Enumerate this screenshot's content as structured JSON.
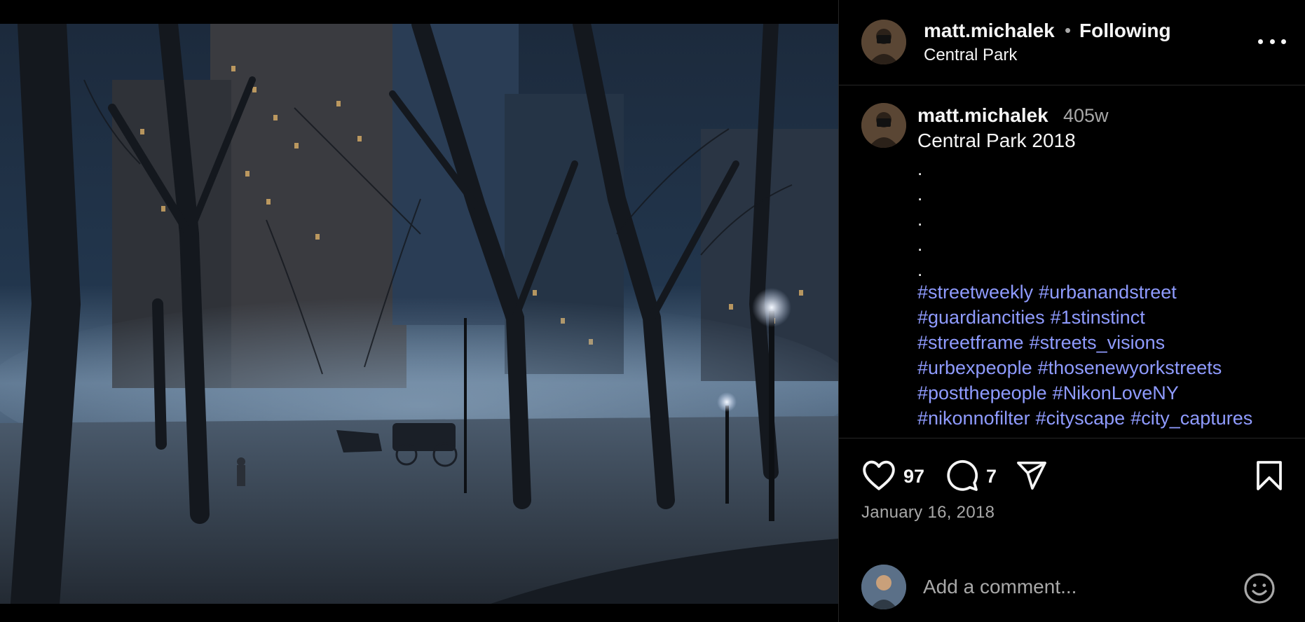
{
  "header": {
    "username": "matt.michalek",
    "separator": "•",
    "follow_status": "Following",
    "location": "Central Park",
    "more_icon": "more-horizontal-icon"
  },
  "caption": {
    "username": "matt.michalek",
    "time": "405w",
    "text": "Central Park 2018",
    "dots": [
      ".",
      ".",
      ".",
      ".",
      "."
    ],
    "tag_lines": [
      [
        "#streetweekly",
        "#urbanandstreet"
      ],
      [
        "#guardiancities",
        "#1stinstinct"
      ],
      [
        "#streetframe",
        "#streets_visions"
      ],
      [
        "#urbexpeople",
        "#thosenewyorkstreets"
      ],
      [
        "#postthepeople",
        "#NikonLoveNY"
      ],
      [
        "#nikonnofilter",
        "#cityscape",
        "#city_captures"
      ]
    ],
    "tag_color": "#8f9bff"
  },
  "actions": {
    "like_icon": "heart-icon",
    "likes": "97",
    "comment_icon": "comment-bubble-icon",
    "comments": "7",
    "share_icon": "paper-plane-icon",
    "save_icon": "bookmark-icon"
  },
  "post_date": "January 16, 2018",
  "comment_box": {
    "placeholder": "Add a comment...",
    "emoji_icon": "smiley-icon"
  }
}
